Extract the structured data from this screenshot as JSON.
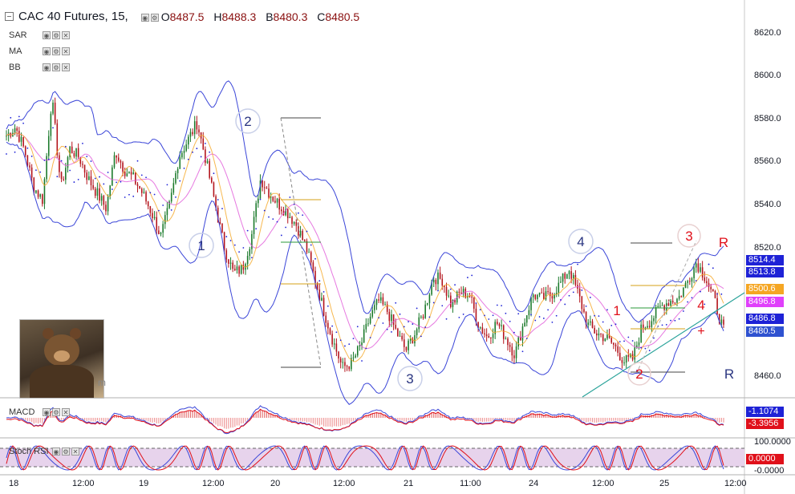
{
  "header": {
    "title": "CAC 40 Futures, 15,",
    "ohlc": [
      {
        "k": "O",
        "v": "8487.5"
      },
      {
        "k": "H",
        "v": "8488.3"
      },
      {
        "k": "B",
        "v": "8480.3"
      },
      {
        "k": "C",
        "v": "8480.5"
      }
    ]
  },
  "indicators": [
    "SAR",
    "MA",
    "BB"
  ],
  "watermark": "m",
  "panes": {
    "macd": "MACD",
    "stoch": "Stoch RSI"
  },
  "price_axis": {
    "ticks": [
      "8620.0",
      "8600.0",
      "8580.0",
      "8560.0",
      "8540.0",
      "8520.0",
      "8460.0"
    ],
    "labels": [
      {
        "text": "8514.4",
        "color": "#1e22d6"
      },
      {
        "text": "8513.8",
        "color": "#1e22d6"
      },
      {
        "text": "8500.6",
        "color": "#f5a623"
      },
      {
        "text": "8496.8",
        "color": "#e040fb"
      },
      {
        "text": "8486.8",
        "color": "#1e22d6"
      },
      {
        "text": "8480.5",
        "color": "#2f52d0"
      }
    ]
  },
  "macd_axis": {
    "labels": [
      {
        "text": "-1.1074",
        "color": "#1e22d6"
      },
      {
        "text": "-3.3956",
        "color": "#e0101a"
      }
    ]
  },
  "stoch_axis": {
    "ticks": [
      "100.0000",
      "-0.0000"
    ],
    "labels": [
      {
        "text": "0.0000",
        "color": "#e0101a"
      }
    ]
  },
  "time_axis": [
    "18",
    "12:00",
    "19",
    "12:00",
    "20",
    "12:00",
    "21",
    "11:00",
    "24",
    "12:00",
    "25",
    "12:00"
  ],
  "annotations": [
    "1",
    "2",
    "3",
    "4",
    "1",
    "2",
    "3",
    "4",
    "R",
    "R",
    "+"
  ],
  "chart_data": {
    "type": "candlestick",
    "title": "CAC 40 Futures, 15,",
    "ylim": [
      8455,
      8625
    ],
    "close_path": [
      8572,
      8576,
      8565,
      8548,
      8542,
      8590,
      8548,
      8566,
      8562,
      8552,
      8545,
      8538,
      8565,
      8556,
      8552,
      8545,
      8536,
      8525,
      8540,
      8562,
      8570,
      8578,
      8560,
      8540,
      8520,
      8508,
      8510,
      8525,
      8552,
      8545,
      8540,
      8536,
      8530,
      8520,
      8505,
      8490,
      8476,
      8464,
      8466,
      8474,
      8487,
      8495,
      8490,
      8480,
      8472,
      8480,
      8490,
      8506,
      8505,
      8493,
      8499,
      8498,
      8484,
      8478,
      8485,
      8478,
      8470,
      8485,
      8498,
      8496,
      8498,
      8503,
      8510,
      8498,
      8484,
      8480,
      8478,
      8474,
      8467,
      8468,
      8483,
      8486,
      8492,
      8495,
      8496,
      8504,
      8513,
      8506,
      8495,
      8481
    ],
    "legend": "top-left"
  }
}
